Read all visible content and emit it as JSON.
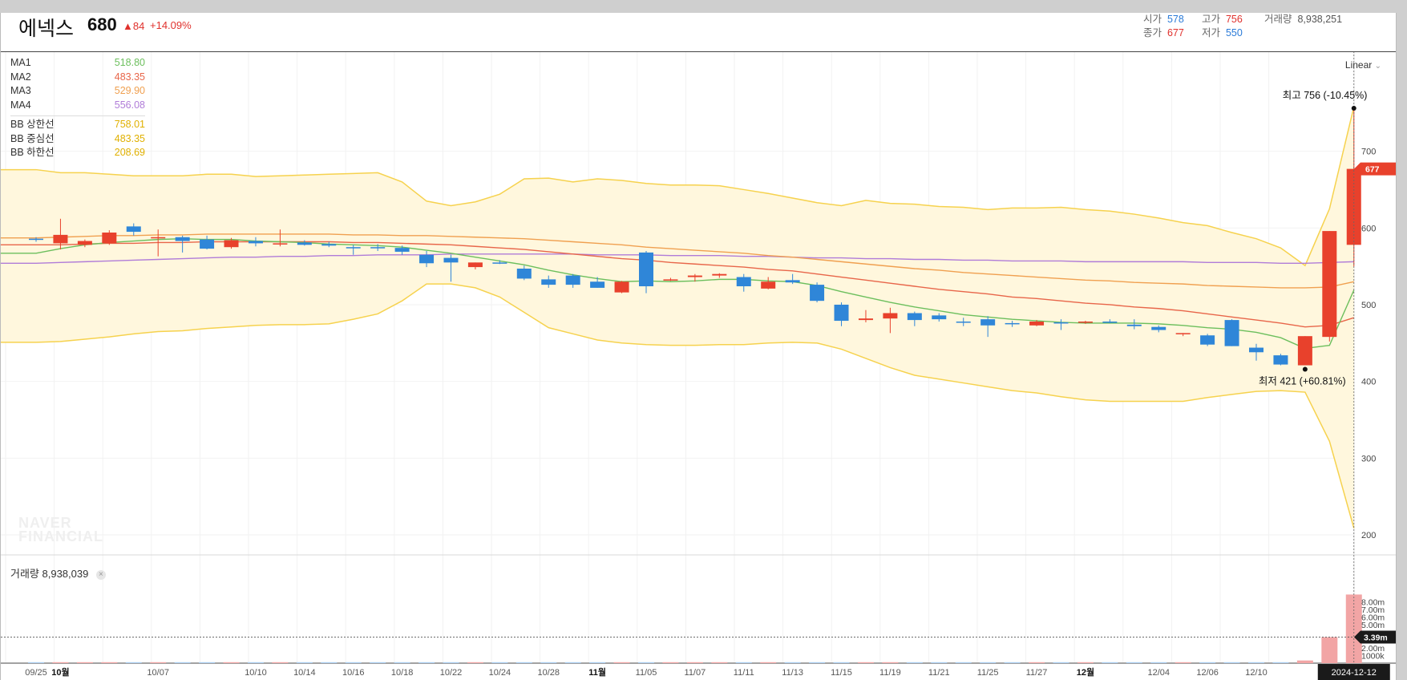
{
  "header": {
    "name": "에넥스",
    "price": "680",
    "change": "▲84",
    "change_pct": "+14.09%",
    "open_label": "시가",
    "open": "578",
    "high_label": "고가",
    "high": "756",
    "volume_label": "거래량",
    "volume": "8,938,251",
    "close_label": "종가",
    "close": "677",
    "low_label": "저가",
    "low": "550"
  },
  "legend": {
    "ma": [
      {
        "name": "MA1",
        "value": "518.80",
        "color": "#6cbf5d"
      },
      {
        "name": "MA2",
        "value": "483.35",
        "color": "#e8664a"
      },
      {
        "name": "MA3",
        "value": "529.90",
        "color": "#f0a050"
      },
      {
        "name": "MA4",
        "value": "556.08",
        "color": "#b07cd8"
      }
    ],
    "bb": [
      {
        "name": "BB 상한선",
        "value": "758.01",
        "color": "#f2c01c"
      },
      {
        "name": "BB 중심선",
        "value": "483.35",
        "color": "#f2c01c"
      },
      {
        "name": "BB 하한선",
        "value": "208.69",
        "color": "#f2c01c"
      }
    ]
  },
  "scale_mode": "Linear",
  "volume_panel": {
    "label": "거래량 8,938,039",
    "close_icon": "close-icon"
  },
  "watermark": [
    "NAVER",
    "FINANCIAL"
  ],
  "annotations": {
    "high": "최고 756 (-10.45%)",
    "low": "최저 421 (+60.81%)"
  },
  "colors": {
    "up": "#e8412c",
    "down": "#2f86d8",
    "bb_fill": "#fff7dd",
    "bb_line": "#f6d24e"
  },
  "chart_data": {
    "type": "candlestick",
    "price_ylim": [
      200,
      756
    ],
    "price_ticks": [
      200,
      300,
      400,
      500,
      600,
      700
    ],
    "price_tag": "677",
    "volume_ticks": [
      "8.00m",
      "7.00m",
      "6.00m",
      "5.00m",
      "3.39m",
      "2.00m",
      "1000k"
    ],
    "volume_tag": "3.39m",
    "x_labels": [
      "09/25",
      "10월",
      "10/07",
      "10/10",
      "10/14",
      "10/16",
      "10/18",
      "10/22",
      "10/24",
      "10/28",
      "11월",
      "11/05",
      "11/07",
      "11/11",
      "11/13",
      "11/15",
      "11/19",
      "11/21",
      "11/25",
      "11/27",
      "12월",
      "12/04",
      "12/06",
      "12/10",
      "2024-12-12"
    ],
    "candles": [
      {
        "o": 586,
        "h": 588,
        "l": 582,
        "c": 585
      },
      {
        "o": 580,
        "h": 612,
        "l": 572,
        "c": 591
      },
      {
        "o": 578,
        "h": 585,
        "l": 575,
        "c": 583
      },
      {
        "o": 580,
        "h": 597,
        "l": 578,
        "c": 594
      },
      {
        "o": 602,
        "h": 606,
        "l": 590,
        "c": 595
      },
      {
        "o": 588,
        "h": 598,
        "l": 563,
        "c": 588
      },
      {
        "o": 588,
        "h": 590,
        "l": 568,
        "c": 583
      },
      {
        "o": 585,
        "h": 590,
        "l": 572,
        "c": 573
      },
      {
        "o": 575,
        "h": 587,
        "l": 573,
        "c": 584
      },
      {
        "o": 583,
        "h": 588,
        "l": 576,
        "c": 580
      },
      {
        "o": 580,
        "h": 598,
        "l": 576,
        "c": 580
      },
      {
        "o": 581,
        "h": 584,
        "l": 577,
        "c": 578
      },
      {
        "o": 579,
        "h": 582,
        "l": 575,
        "c": 577
      },
      {
        "o": 575,
        "h": 578,
        "l": 565,
        "c": 574
      },
      {
        "o": 575,
        "h": 579,
        "l": 570,
        "c": 574
      },
      {
        "o": 574,
        "h": 577,
        "l": 565,
        "c": 569
      },
      {
        "o": 565,
        "h": 570,
        "l": 549,
        "c": 554
      },
      {
        "o": 561,
        "h": 565,
        "l": 530,
        "c": 555
      },
      {
        "o": 549,
        "h": 555,
        "l": 546,
        "c": 555
      },
      {
        "o": 555,
        "h": 558,
        "l": 553,
        "c": 554
      },
      {
        "o": 547,
        "h": 551,
        "l": 532,
        "c": 534
      },
      {
        "o": 533,
        "h": 538,
        "l": 522,
        "c": 526
      },
      {
        "o": 538,
        "h": 540,
        "l": 522,
        "c": 526
      },
      {
        "o": 530,
        "h": 536,
        "l": 522,
        "c": 522
      },
      {
        "o": 516,
        "h": 531,
        "l": 515,
        "c": 530
      },
      {
        "o": 568,
        "h": 570,
        "l": 515,
        "c": 524
      },
      {
        "o": 532,
        "h": 535,
        "l": 531,
        "c": 533
      },
      {
        "o": 536,
        "h": 540,
        "l": 530,
        "c": 538
      },
      {
        "o": 538,
        "h": 541,
        "l": 535,
        "c": 540
      },
      {
        "o": 536,
        "h": 540,
        "l": 517,
        "c": 524
      },
      {
        "o": 521,
        "h": 536,
        "l": 520,
        "c": 530
      },
      {
        "o": 532,
        "h": 540,
        "l": 527,
        "c": 529
      },
      {
        "o": 526,
        "h": 529,
        "l": 503,
        "c": 505
      },
      {
        "o": 500,
        "h": 503,
        "l": 472,
        "c": 479
      },
      {
        "o": 480,
        "h": 493,
        "l": 477,
        "c": 482
      },
      {
        "o": 482,
        "h": 496,
        "l": 463,
        "c": 489
      },
      {
        "o": 489,
        "h": 491,
        "l": 472,
        "c": 480
      },
      {
        "o": 486,
        "h": 489,
        "l": 478,
        "c": 481
      },
      {
        "o": 478,
        "h": 483,
        "l": 472,
        "c": 477
      },
      {
        "o": 481,
        "h": 485,
        "l": 458,
        "c": 473
      },
      {
        "o": 476,
        "h": 479,
        "l": 471,
        "c": 475
      },
      {
        "o": 473,
        "h": 480,
        "l": 472,
        "c": 478
      },
      {
        "o": 477,
        "h": 481,
        "l": 467,
        "c": 476
      },
      {
        "o": 477,
        "h": 479,
        "l": 475,
        "c": 478
      },
      {
        "o": 478,
        "h": 481,
        "l": 476,
        "c": 477
      },
      {
        "o": 474,
        "h": 481,
        "l": 468,
        "c": 472
      },
      {
        "o": 471,
        "h": 473,
        "l": 464,
        "c": 467
      },
      {
        "o": 462,
        "h": 463,
        "l": 459,
        "c": 463
      },
      {
        "o": 460,
        "h": 462,
        "l": 446,
        "c": 448
      },
      {
        "o": 480,
        "h": 481,
        "l": 446,
        "c": 446
      },
      {
        "o": 444,
        "h": 449,
        "l": 427,
        "c": 438
      },
      {
        "o": 434,
        "h": 436,
        "l": 421,
        "c": 422
      },
      {
        "o": 421,
        "h": 459,
        "l": 421,
        "c": 459
      },
      {
        "o": 458,
        "h": 596,
        "l": 452,
        "c": 596
      },
      {
        "o": 578,
        "h": 756,
        "l": 550,
        "c": 677
      }
    ],
    "volume": [
      0.02,
      0.02,
      0.02,
      0.05,
      0.04,
      0.03,
      0.02,
      0.02,
      0.02,
      0.02,
      0.02,
      0.02,
      0.02,
      0.02,
      0.02,
      0.02,
      0.02,
      0.02,
      0.02,
      0.02,
      0.02,
      0.02,
      0.02,
      0.02,
      0.02,
      0.04,
      0.02,
      0.02,
      0.02,
      0.02,
      0.02,
      0.02,
      0.02,
      0.02,
      0.02,
      0.05,
      0.12,
      0.02,
      0.02,
      0.05,
      0.02,
      0.02,
      0.02,
      0.02,
      0.02,
      0.02,
      0.02,
      0.02,
      0.04,
      0.05,
      0.02,
      0.02,
      0.35,
      3.39,
      8.94
    ],
    "ma1": [
      567,
      573,
      578,
      581,
      583,
      585,
      586,
      585,
      585,
      583,
      582,
      581,
      579,
      578,
      577,
      575,
      571,
      567,
      562,
      557,
      552,
      545,
      539,
      534,
      530,
      531,
      530,
      531,
      533,
      533,
      531,
      530,
      525,
      517,
      510,
      503,
      497,
      492,
      487,
      484,
      481,
      479,
      477,
      476,
      476,
      476,
      475,
      473,
      470,
      468,
      464,
      457,
      443,
      447,
      519
    ],
    "ma2": [
      578,
      578,
      579,
      580,
      580,
      581,
      581,
      582,
      582,
      582,
      582,
      582,
      582,
      581,
      581,
      580,
      579,
      578,
      576,
      574,
      572,
      569,
      566,
      563,
      560,
      558,
      555,
      553,
      551,
      549,
      546,
      544,
      540,
      536,
      532,
      528,
      524,
      520,
      517,
      514,
      510,
      508,
      505,
      502,
      500,
      497,
      495,
      492,
      488,
      484,
      480,
      476,
      471,
      473,
      483
    ],
    "ma3": [
      587,
      588,
      589,
      590,
      590,
      591,
      591,
      592,
      592,
      592,
      592,
      592,
      592,
      591,
      591,
      590,
      590,
      589,
      588,
      587,
      586,
      584,
      582,
      580,
      578,
      575,
      573,
      571,
      569,
      567,
      564,
      562,
      559,
      556,
      553,
      550,
      547,
      545,
      542,
      540,
      538,
      536,
      534,
      532,
      531,
      529,
      528,
      527,
      525,
      524,
      523,
      522,
      522,
      523,
      530
    ],
    "ma4": [
      554,
      555,
      556,
      557,
      558,
      559,
      560,
      561,
      562,
      562,
      563,
      563,
      564,
      564,
      565,
      565,
      565,
      566,
      566,
      566,
      566,
      566,
      566,
      565,
      565,
      565,
      564,
      564,
      564,
      563,
      563,
      562,
      561,
      561,
      560,
      560,
      559,
      559,
      558,
      558,
      557,
      557,
      557,
      556,
      556,
      556,
      556,
      556,
      555,
      555,
      555,
      554,
      554,
      555,
      556
    ],
    "bb_upper": [
      676,
      672,
      672,
      670,
      668,
      668,
      668,
      670,
      670,
      667,
      668,
      669,
      670,
      671,
      672,
      660,
      635,
      629,
      634,
      644,
      664,
      665,
      660,
      664,
      662,
      658,
      656,
      656,
      655,
      650,
      645,
      639,
      633,
      629,
      636,
      632,
      631,
      628,
      627,
      624,
      626,
      626,
      627,
      624,
      622,
      618,
      613,
      607,
      603,
      594,
      586,
      574,
      551,
      625,
      758
    ],
    "bb_lower": [
      451,
      452,
      455,
      458,
      462,
      465,
      466,
      469,
      471,
      473,
      474,
      474,
      475,
      481,
      488,
      505,
      527,
      527,
      522,
      510,
      490,
      470,
      462,
      454,
      450,
      448,
      447,
      447,
      448,
      448,
      450,
      451,
      450,
      442,
      430,
      418,
      408,
      403,
      398,
      393,
      388,
      385,
      380,
      376,
      374,
      374,
      374,
      374,
      379,
      383,
      387,
      388,
      386,
      322,
      208.69
    ]
  }
}
